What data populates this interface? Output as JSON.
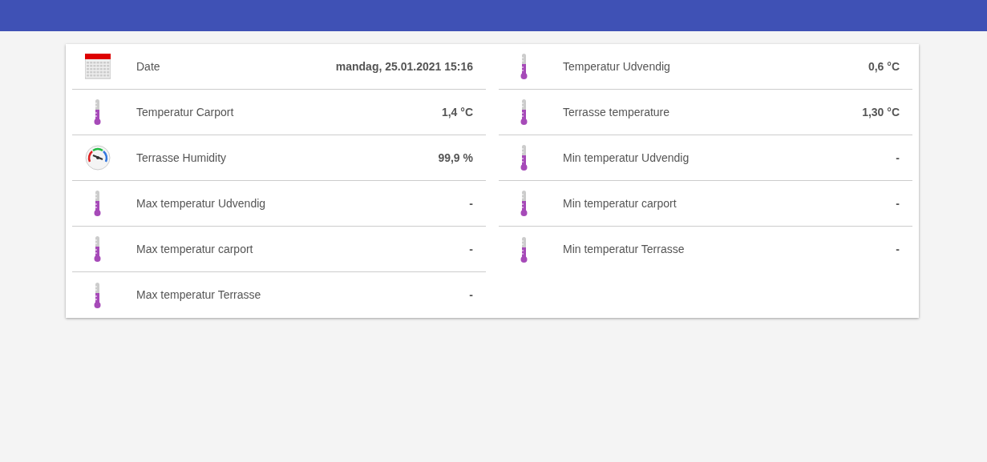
{
  "columns": [
    {
      "items": [
        {
          "kind": "calendar",
          "label": "Date",
          "value": "mandag, 25.01.2021 15:16"
        },
        {
          "kind": "thermometer",
          "label": "Temperatur Carport",
          "value": "1,4 °C"
        },
        {
          "kind": "gauge",
          "label": "Terrasse Humidity",
          "value": "99,9 %"
        },
        {
          "kind": "thermometer",
          "label": "Max temperatur Udvendig",
          "value": "-"
        },
        {
          "kind": "thermometer",
          "label": "Max temperatur carport",
          "value": "-"
        },
        {
          "kind": "thermometer",
          "label": "Max temperatur Terrasse",
          "value": "-"
        }
      ]
    },
    {
      "items": [
        {
          "kind": "thermometer",
          "label": "Temperatur Udvendig",
          "value": "0,6 °C"
        },
        {
          "kind": "thermometer",
          "label": "Terrasse temperature",
          "value": "1,30 °C"
        },
        {
          "kind": "thermometer",
          "label": "Min temperatur Udvendig",
          "value": "-"
        },
        {
          "kind": "thermometer",
          "label": "Min temperatur carport",
          "value": "-"
        },
        {
          "kind": "thermometer",
          "label": "Min temperatur Terrasse",
          "value": "-"
        }
      ]
    }
  ]
}
